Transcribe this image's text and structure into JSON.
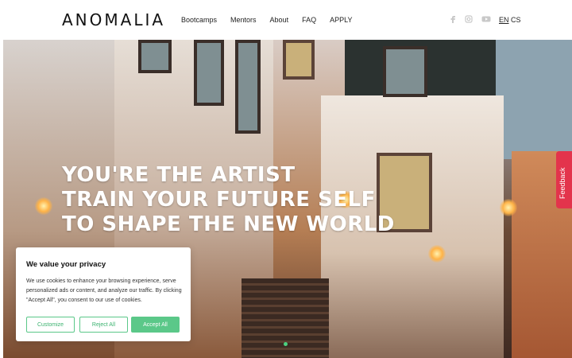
{
  "header": {
    "logo": "ANOMALIA",
    "nav": [
      "Bootcamps",
      "Mentors",
      "About",
      "FAQ",
      "APPLY"
    ],
    "social_icons": [
      "facebook-icon",
      "instagram-icon",
      "youtube-icon"
    ],
    "languages": [
      "EN",
      "CS"
    ],
    "active_language": "EN"
  },
  "hero": {
    "headline_lines": [
      "YOU'RE THE ARTIST",
      "TRAIN YOUR FUTURE SELF",
      "TO SHAPE THE NEW WORLD"
    ]
  },
  "feedback": {
    "label": "Feedback"
  },
  "cookie": {
    "title": "We value your privacy",
    "text": "We use cookies to enhance your browsing experience, serve personalized ads or content, and analyze our traffic. By clicking \"Accept All\", you consent to our use of cookies.",
    "buttons": {
      "customize": "Customize",
      "reject": "Reject All",
      "accept": "Accept All"
    }
  },
  "colors": {
    "accent": "#5bc889",
    "feedback": "#e3344c",
    "slider_dot": "#4cd080"
  }
}
